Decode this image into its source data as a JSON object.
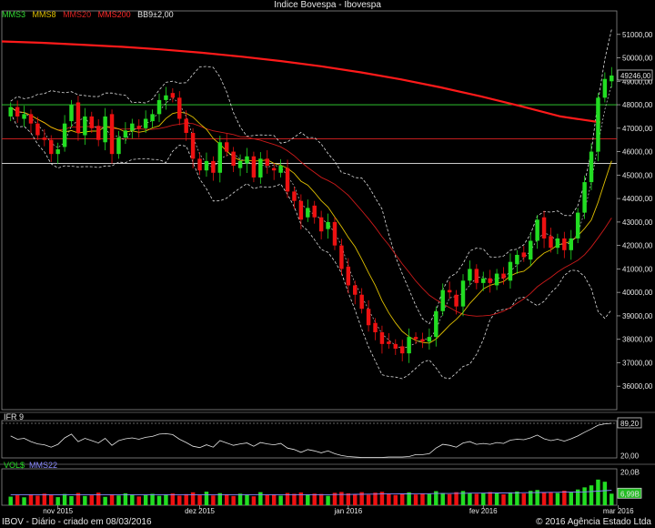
{
  "title": "Indice Bovespa - Ibovespa",
  "legend": [
    {
      "label": "MMS3",
      "color": "#33dd33"
    },
    {
      "label": "MMS8",
      "color": "#e0c000"
    },
    {
      "label": "MMS20",
      "color": "#dd2222"
    },
    {
      "label": "MMS200",
      "color": "#ff2a2a"
    },
    {
      "label": "BB9±2,00",
      "color": "#e6e6e6"
    }
  ],
  "footer_left": "IBOV - Diário - criado em 08/03/2016",
  "footer_right": "© 2016 Agência Estado Ltda",
  "colors": {
    "up": "#22dd22",
    "down": "#ee1111",
    "ma3": "#cccccc",
    "ma8": "#e0c000",
    "ma20": "#cc1a1a",
    "ma200": "#ff1a1a",
    "bb": "#dddddd",
    "hline": "#33dd33",
    "hline_red": "#dd2222",
    "hline_white": "#e6e6e6"
  },
  "chart_data": [
    {
      "type": "candlestick",
      "title": "Indice Bovespa - Ibovespa",
      "x_labels": [
        "nov 2015",
        "dez 2015",
        "jan 2016",
        "fev 2016",
        "mar 2016"
      ],
      "x_label_index": [
        7,
        28,
        50,
        70,
        90
      ],
      "ylim": [
        35000,
        52000
      ],
      "y_ticks": [
        "36000,00",
        "37000,00",
        "38000,00",
        "39000,00",
        "40000,00",
        "41000,00",
        "42000,00",
        "43000,00",
        "44000,00",
        "45000,00",
        "46000,00",
        "47000,00",
        "48000,00",
        "49000,00",
        "50000,00",
        "51000,00"
      ],
      "y_tick_values": [
        36000,
        37000,
        38000,
        39000,
        40000,
        41000,
        42000,
        43000,
        44000,
        45000,
        46000,
        47000,
        48000,
        49000,
        50000,
        51000
      ],
      "last_value_label": "49246,00",
      "last_value": 49246,
      "horizontal_lines": [
        48000,
        46550,
        45500
      ],
      "ma200": [
        50700,
        50640,
        50560,
        50470,
        50360,
        50220,
        50050,
        49860,
        49640,
        49380,
        49080,
        48740,
        48360,
        47940,
        47500,
        47250
      ],
      "closes": [
        47900,
        47500,
        47600,
        47200,
        46700,
        46500,
        45900,
        46100,
        47200,
        48000,
        46800,
        47500,
        47000,
        46500,
        47500,
        45900,
        46600,
        46900,
        47200,
        47000,
        47400,
        47600,
        48200,
        48400,
        48300,
        47400,
        46800,
        45700,
        45200,
        45600,
        45100,
        46400,
        46000,
        45400,
        45600,
        45800,
        44900,
        45700,
        45400,
        45200,
        45400,
        44300,
        43900,
        43100,
        43600,
        43200,
        42600,
        43000,
        42000,
        41000,
        40300,
        39900,
        39300,
        38600,
        38300,
        37800,
        37800,
        37600,
        37400,
        38100,
        38000,
        37900,
        38100,
        39200,
        40100,
        40000,
        39400,
        40500,
        41000,
        40400,
        40600,
        40400,
        40800,
        40600,
        41300,
        41600,
        41500,
        42200,
        43100,
        42300,
        41900,
        42300,
        41800,
        42300,
        43400,
        44700,
        46000,
        48300,
        49100,
        49246
      ],
      "opens": [
        47500,
        47900,
        47400,
        47600,
        47200,
        46600,
        46500,
        45900,
        46200,
        47300,
        48100,
        46700,
        47500,
        47100,
        46400,
        47600,
        45900,
        46600,
        46900,
        47100,
        47000,
        47300,
        47600,
        48200,
        48500,
        48300,
        47400,
        46800,
        45700,
        45200,
        45600,
        45100,
        46400,
        46000,
        45300,
        45500,
        45800,
        44900,
        45700,
        45300,
        45100,
        45300,
        44300,
        43900,
        43200,
        43700,
        43200,
        42700,
        43000,
        42000,
        41100,
        40300,
        39900,
        39300,
        38700,
        38300,
        37900,
        37800,
        37700,
        37400,
        38100,
        38000,
        37900,
        38100,
        39200,
        40100,
        39900,
        39400,
        40500,
        41000,
        40400,
        40600,
        40300,
        40800,
        40500,
        41200,
        41700,
        41400,
        42200,
        43200,
        42400,
        41900,
        42300,
        41800,
        42300,
        43400,
        44700,
        46000,
        48300,
        49000
      ]
    },
    {
      "type": "line",
      "title": "IFR 9",
      "ylim": [
        15,
        95
      ],
      "y_ticks": [
        "20,00",
        "89,20"
      ],
      "y_tick_values": [
        20,
        89.2
      ],
      "values": [
        62,
        55,
        57,
        50,
        45,
        43,
        38,
        44,
        58,
        66,
        50,
        57,
        52,
        47,
        57,
        42,
        52,
        56,
        58,
        55,
        59,
        61,
        66,
        67,
        65,
        55,
        48,
        40,
        37,
        43,
        38,
        52,
        47,
        42,
        45,
        47,
        40,
        48,
        45,
        43,
        46,
        36,
        33,
        27,
        33,
        30,
        26,
        30,
        24,
        20,
        18,
        17,
        16,
        16,
        16,
        16,
        17,
        17,
        17,
        18,
        22,
        22,
        24,
        36,
        44,
        42,
        38,
        47,
        50,
        44,
        46,
        44,
        48,
        46,
        53,
        55,
        54,
        58,
        64,
        56,
        52,
        55,
        51,
        56,
        62,
        70,
        77,
        85,
        88,
        89.2
      ],
      "reference_line": 89.2
    },
    {
      "type": "bar",
      "title": "VOL$",
      "ma_label": "MMS22",
      "y_ticks": [
        "20,0B",
        "6,99B"
      ],
      "y_tick_values": [
        20,
        6.99
      ],
      "ylim": [
        0,
        22
      ],
      "values": [
        5.2,
        6.0,
        4.8,
        6.5,
        5.8,
        7.0,
        6.2,
        4.9,
        6.8,
        5.5,
        7.4,
        5.6,
        6.0,
        7.6,
        5.1,
        6.6,
        5.9,
        7.2,
        6.4,
        5.3,
        6.1,
        6.9,
        5.7,
        6.3,
        7.1,
        5.8,
        6.7,
        7.8,
        6.0,
        8.2,
        5.9,
        7.3,
        6.4,
        5.6,
        7.0,
        6.2,
        5.4,
        7.9,
        6.1,
        6.6,
        5.8,
        7.4,
        6.9,
        7.7,
        6.3,
        7.0,
        6.8,
        5.7,
        7.5,
        8.0,
        7.2,
        6.6,
        7.9,
        6.4,
        7.6,
        8.1,
        7.0,
        6.2,
        6.9,
        7.8,
        6.5,
        7.1,
        6.8,
        8.5,
        7.4,
        6.7,
        7.9,
        8.6,
        7.2,
        6.9,
        7.5,
        8.0,
        7.3,
        6.6,
        7.8,
        8.3,
        7.1,
        8.7,
        9.2,
        7.6,
        8.0,
        7.4,
        8.8,
        7.9,
        9.5,
        10.8,
        12.0,
        15.5,
        14.2,
        6.99
      ],
      "ma22": [
        6.4,
        6.4,
        6.4,
        6.4,
        6.4,
        6.4,
        6.4,
        6.4,
        6.4,
        6.4,
        6.4,
        6.4,
        6.4,
        6.4,
        6.4,
        6.4,
        6.4,
        6.4,
        6.4,
        6.4,
        6.4,
        6.4,
        6.4,
        6.4,
        6.4,
        6.4,
        6.4,
        6.4,
        6.4,
        6.4,
        6.4,
        6.4,
        6.4,
        6.4,
        6.4,
        6.4,
        6.4,
        6.4,
        6.4,
        6.4,
        6.4,
        6.4,
        6.4,
        6.4,
        6.4,
        6.4,
        6.4,
        6.4,
        6.5,
        6.5,
        6.5,
        6.6,
        6.6,
        6.7,
        6.7,
        6.8,
        6.8,
        6.8,
        6.9,
        6.9,
        7.0,
        7.0,
        7.0,
        7.1,
        7.1,
        7.1,
        7.2,
        7.2,
        7.3,
        7.3,
        7.3,
        7.4,
        7.4,
        7.4,
        7.5,
        7.5,
        7.6,
        7.6,
        7.7,
        7.7,
        7.8,
        7.8,
        7.9,
        7.9,
        8.0,
        8.1,
        8.3,
        8.5,
        8.8,
        9.0
      ]
    }
  ]
}
